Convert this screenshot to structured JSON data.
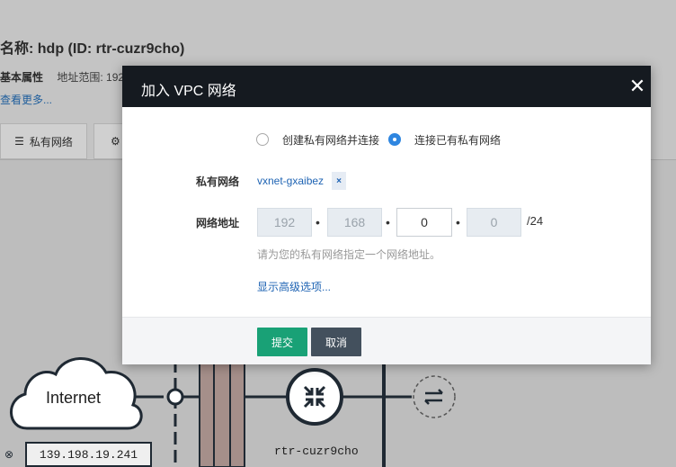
{
  "background": {
    "title": "名称: hdp (ID: rtr-cuzr9cho)",
    "attr_label": "基本属性",
    "attr_sub": "地址范围: 192",
    "more_link": "查看更多...",
    "tabs": [
      {
        "label": "私有网络",
        "icon": "list-icon"
      },
      {
        "label": "",
        "icon": "gear-icon"
      }
    ],
    "topology": {
      "internet_label": "Internet",
      "ip_address": "139.198.19.241",
      "router_name": "rtr-cuzr9cho"
    }
  },
  "modal": {
    "title": "加入 VPC 网络",
    "close_icon": "close-icon",
    "radio_options": [
      {
        "label": "创建私有网络并连接",
        "checked": false
      },
      {
        "label": "连接已有私有网络",
        "checked": true
      }
    ],
    "vxnet": {
      "label": "私有网络",
      "value": "vxnet-gxaibez",
      "remove_symbol": "×"
    },
    "network_address": {
      "label": "网络地址",
      "octets": [
        "192",
        "168",
        "0",
        "0"
      ],
      "dot": "•",
      "mask": "/24",
      "hint": "请为您的私有网络指定一个网络地址。"
    },
    "advanced_link": "显示高级选项...",
    "buttons": {
      "submit": "提交",
      "cancel": "取消"
    },
    "colors": {
      "header_bg": "#151a20",
      "submit": "#19a176",
      "cancel": "#43505d",
      "link": "#1e63b3",
      "radio_checked": "#2f86e0"
    }
  }
}
